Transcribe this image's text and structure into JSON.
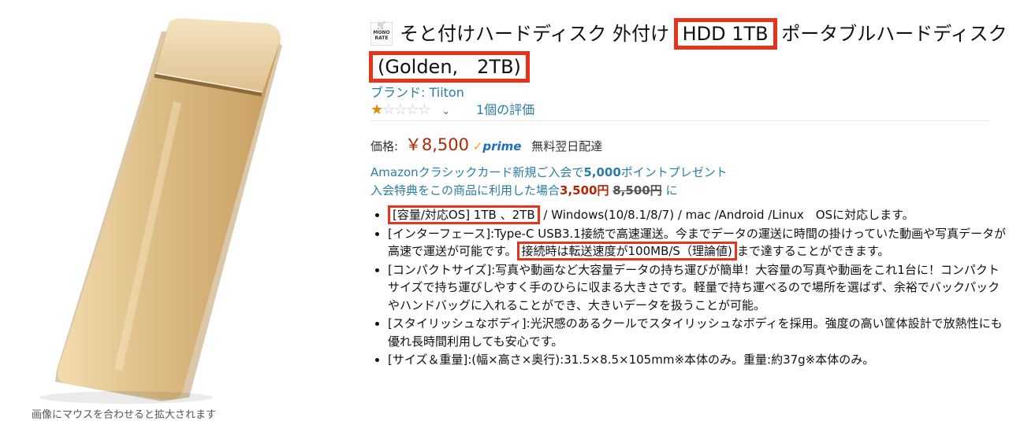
{
  "product": {
    "logo_text": "MONO RATE",
    "title_part1": "そと付けハードディスク 外付け",
    "title_highlight1": "HDD 1TB",
    "title_part2": "ポータブルハードディスク",
    "title_highlight2": "(Golden,　2TB)",
    "brand": "ブランド: Tiiton",
    "rating_count": "1個の評価",
    "stars_filled": 1,
    "stars_total": 5
  },
  "price": {
    "label": "価格:",
    "value": "￥8,500",
    "prime": "prime",
    "shipping": "無料翌日配達"
  },
  "promo": {
    "line1_pre": "Amazonクラシックカード新規ご入会で",
    "line1_bold": "5,000",
    "line1_post": "ポイントプレゼント",
    "line2_pre": "入会特典をこの商品に利用した場合",
    "line2_price": "3,500円",
    "line2_strike": "8,500円",
    "line2_post": "に"
  },
  "bullets": {
    "b1_highlight": "[容量/対応OS] 1TB 、2TB",
    "b1_rest": "/ Windows(10/8.1/8/7) / mac /Android /Linux　OSに対応します。",
    "b2_pre": "[インターフェース]:Type-C USB3.1接続で高速運送。今までデータの運送に時間の掛けっていた動画や写真データが高速で運送が可能です。",
    "b2_highlight": "接続時は転送速度が100MB/S（理論値)",
    "b2_post": "まで達することができます。",
    "b3": "[コンパクトサイズ]:写真や動画など大容量データの持ち運びが簡単！大容量の写真や動画をこれ1台に！コンパクトサイズで持ち運びしやすく手のひらに収まる大きさです。軽量で持ち運べるので場所を選ばず、余裕でバックパックやハンドバッグに入れることができ、大きいデータを扱うことが可能。",
    "b4": "[スタイリッシュなボディ]:光沢感のあるクールでスタイリッシュなボディを採用。強度の高い筐体設計で放熱性にも優れ長時間利用しても安心です。",
    "b5": "[サイズ＆重量]:(幅×高さ×奥行):31.5×8.5×105mm※本体のみ。重量:約37g※本体のみ。"
  },
  "image": {
    "hint": "画像にマウスを合わせると拡大されます"
  },
  "colors": {
    "highlight_border": "#e8321c",
    "link_blue": "#2a7da3",
    "price_red": "#b12704",
    "device_gold": "#d9b880"
  }
}
